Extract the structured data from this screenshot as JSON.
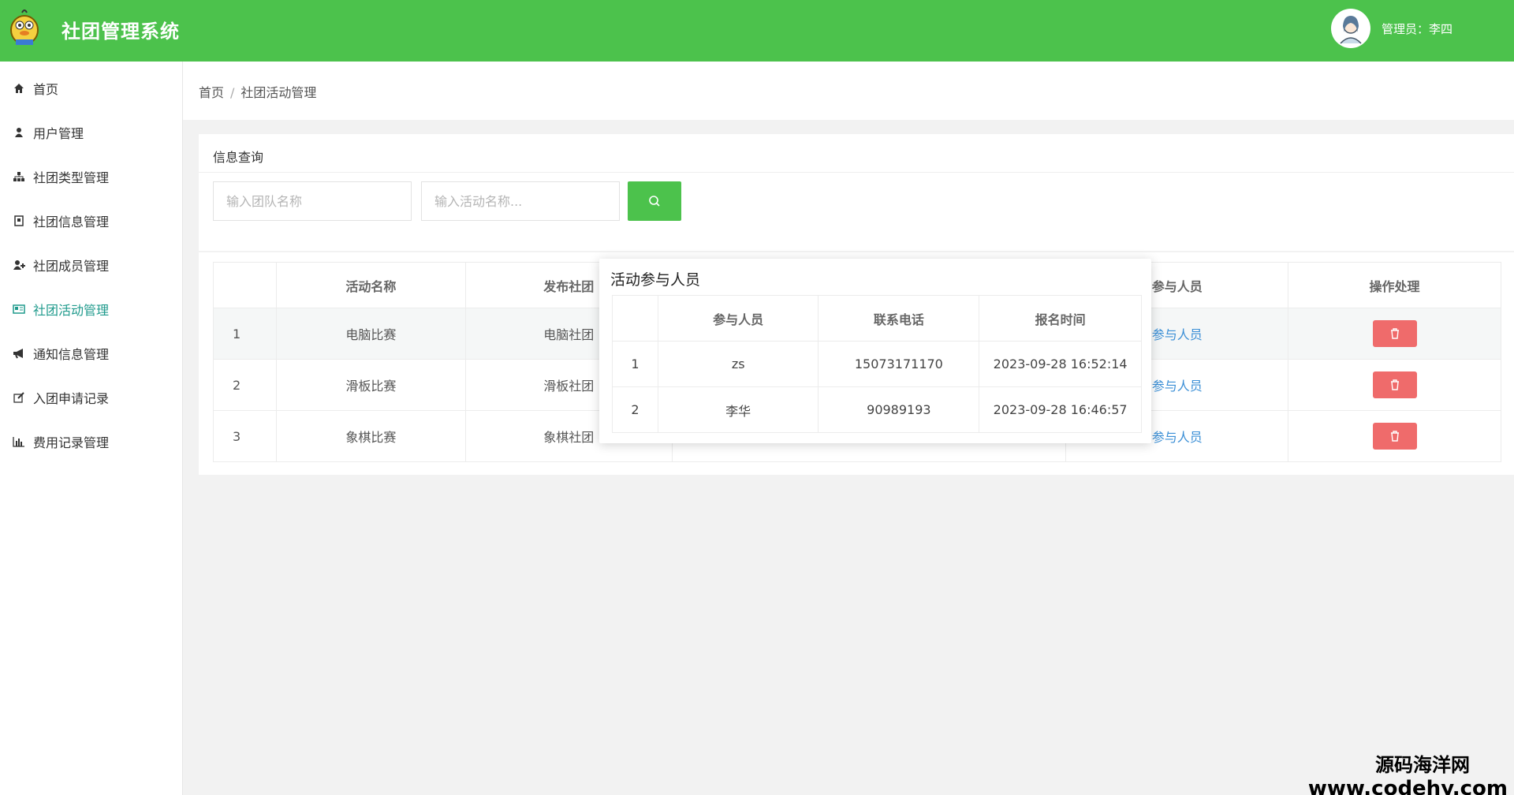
{
  "header": {
    "app_title": "社团管理系统",
    "admin_label": "管理员：李四"
  },
  "sidebar": {
    "items": [
      {
        "label": "首页",
        "icon": "home-icon"
      },
      {
        "label": "用户管理",
        "icon": "user-icon"
      },
      {
        "label": "社团类型管理",
        "icon": "sitemap-icon"
      },
      {
        "label": "社团信息管理",
        "icon": "document-icon"
      },
      {
        "label": "社团成员管理",
        "icon": "user-plus-icon"
      },
      {
        "label": "社团活动管理",
        "icon": "newspaper-icon",
        "active": true
      },
      {
        "label": "通知信息管理",
        "icon": "bullhorn-icon"
      },
      {
        "label": "入团申请记录",
        "icon": "edit-icon"
      },
      {
        "label": "费用记录管理",
        "icon": "bar-chart-icon"
      }
    ]
  },
  "breadcrumb": {
    "home": "首页",
    "separator": "/",
    "current": "社团活动管理"
  },
  "search": {
    "title": "信息查询",
    "team_placeholder": "输入团队名称",
    "activity_placeholder": "输入活动名称..."
  },
  "table": {
    "headers": [
      "",
      "活动名称",
      "发布社团",
      "",
      "参与人员",
      "操作处理"
    ],
    "rows": [
      {
        "index": "1",
        "name": "电脑比赛",
        "club": "电脑社团",
        "participants_link": "参与人员"
      },
      {
        "index": "2",
        "name": "滑板比赛",
        "club": "滑板社团",
        "participants_link": "参与人员"
      },
      {
        "index": "3",
        "name": "象棋比赛",
        "club": "象棋社团",
        "participants_link": "参与人员"
      }
    ]
  },
  "popup": {
    "title": "活动参与人员",
    "headers": [
      "",
      "参与人员",
      "联系电话",
      "报名时间"
    ],
    "rows": [
      {
        "index": "1",
        "name": "zs",
        "phone": "15073171170",
        "time": "2023-09-28 16:52:14"
      },
      {
        "index": "2",
        "name": "李华",
        "phone": "90989193",
        "time": "2023-09-28 16:46:57"
      }
    ]
  },
  "watermark": {
    "line1": "源码海洋网",
    "line2": "www.codehy.com"
  },
  "colors": {
    "header": "#4cc24c",
    "active_nav": "#1f9a8c",
    "link": "#3b8fd6",
    "danger": "#ef6b6b"
  }
}
